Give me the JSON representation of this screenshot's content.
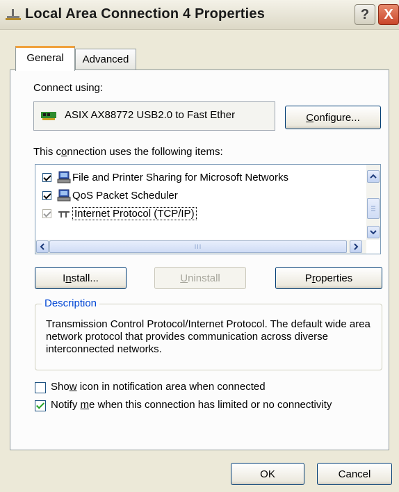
{
  "window": {
    "title": "Local Area Connection 4 Properties",
    "help_label": "?",
    "close_label": "X"
  },
  "tabs": [
    {
      "label": "General"
    },
    {
      "label": "Advanced"
    }
  ],
  "connect": {
    "label_pre": "Connect using:",
    "adapter": "ASIX AX88772 USB2.0 to Fast Ether",
    "configure_pre": "",
    "configure_u": "C",
    "configure_post": "onfigure..."
  },
  "items_section": {
    "label_pre": "This c",
    "label_u": "o",
    "label_post": "nnection uses the following items:"
  },
  "items": [
    {
      "label": "File and Printer Sharing for Microsoft Networks",
      "checked": true
    },
    {
      "label": "QoS Packet Scheduler",
      "checked": true
    },
    {
      "label": "Internet Protocol (TCP/IP)",
      "checked": true,
      "selected": true
    }
  ],
  "scrollbar": {
    "grip": "III"
  },
  "buttons": {
    "install": {
      "pre": "I",
      "u": "n",
      "post": "stall..."
    },
    "uninstall": {
      "pre": "",
      "u": "U",
      "post": "ninstall"
    },
    "properties": {
      "pre": "P",
      "u": "r",
      "post": "operties"
    },
    "ok": "OK",
    "cancel": "Cancel"
  },
  "description": {
    "title": "Description",
    "text": "Transmission Control Protocol/Internet Protocol. The default wide area network protocol that provides communication across diverse interconnected networks."
  },
  "options": [
    {
      "pre": "Sho",
      "u": "w",
      "post": " icon in notification area when connected",
      "checked": false
    },
    {
      "pre": "Notify ",
      "u": "m",
      "post": "e when this connection has limited or no connectivity",
      "checked": true
    }
  ],
  "colors": {
    "accent_tab": "#f0a13c",
    "group_label": "#0046d5",
    "close_button": "#c9452a"
  }
}
